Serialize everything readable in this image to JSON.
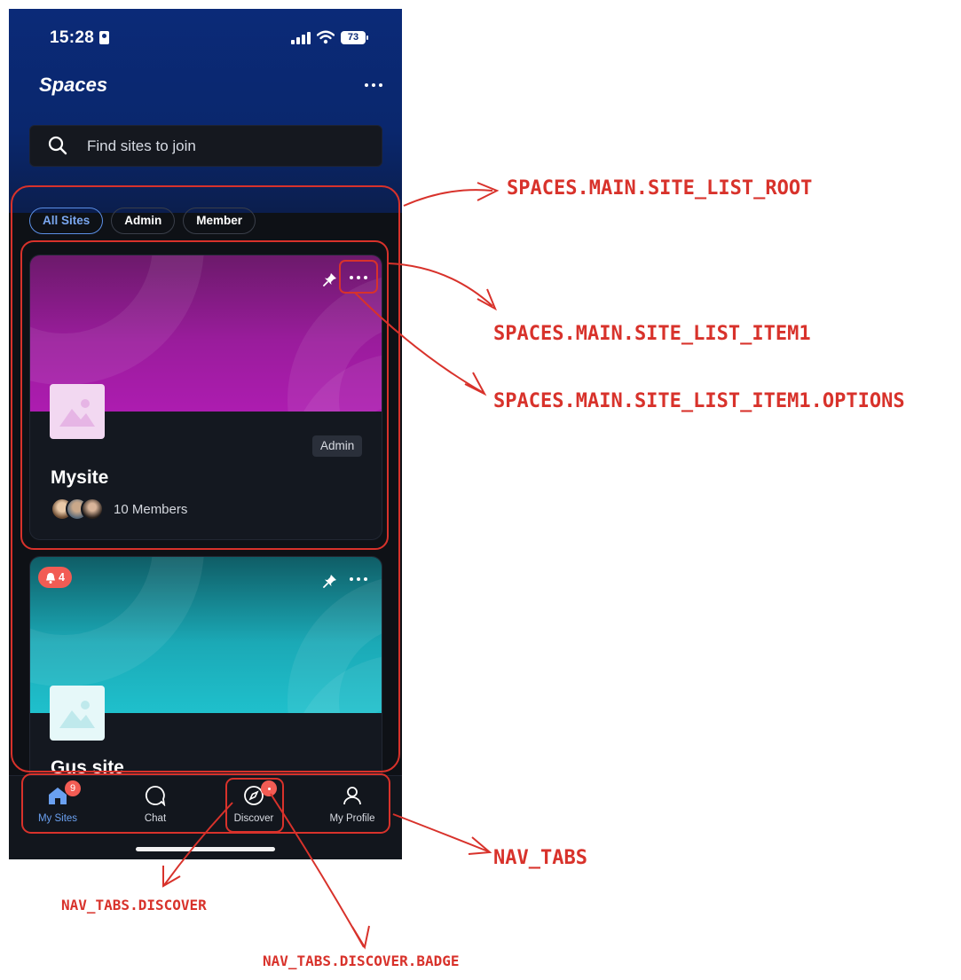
{
  "status_bar": {
    "time": "15:28",
    "battery": "73"
  },
  "header": {
    "title": "Spaces"
  },
  "search": {
    "placeholder": "Find sites to join"
  },
  "filters": {
    "chips": [
      "All Sites",
      "Admin",
      "Member"
    ],
    "active": "All Sites"
  },
  "sites": [
    {
      "name": "Mysite",
      "role": "Admin",
      "members": "10 Members",
      "accent": "#ad1cb0"
    },
    {
      "name": "Gus site",
      "notifications": "4",
      "accent": "#1fc0cc"
    }
  ],
  "nav_tabs": [
    {
      "label": "My Sites",
      "icon": "home-icon",
      "badge": "9",
      "active": true
    },
    {
      "label": "Chat",
      "icon": "chat-icon"
    },
    {
      "label": "Discover",
      "icon": "compass-icon",
      "badge": "dot"
    },
    {
      "label": "My Profile",
      "icon": "profile-icon"
    }
  ],
  "annotations": {
    "site_list_root": "SPACES.MAIN.SITE_LIST_ROOT",
    "site_list_item1": "SPACES.MAIN.SITE_LIST_ITEM1",
    "site_list_item1_options": "SPACES.MAIN.SITE_LIST_ITEM1.OPTIONS",
    "nav_tabs": "NAV_TABS",
    "nav_tabs_discover": "NAV_TABS.DISCOVER",
    "nav_tabs_discover_badge": "NAV_TABS.DISCOVER.BADGE"
  },
  "colors": {
    "annotation": "#d8322b",
    "header_bg": "#0b2a78",
    "active_tab": "#6aa0f0",
    "badge": "#f25c54"
  }
}
